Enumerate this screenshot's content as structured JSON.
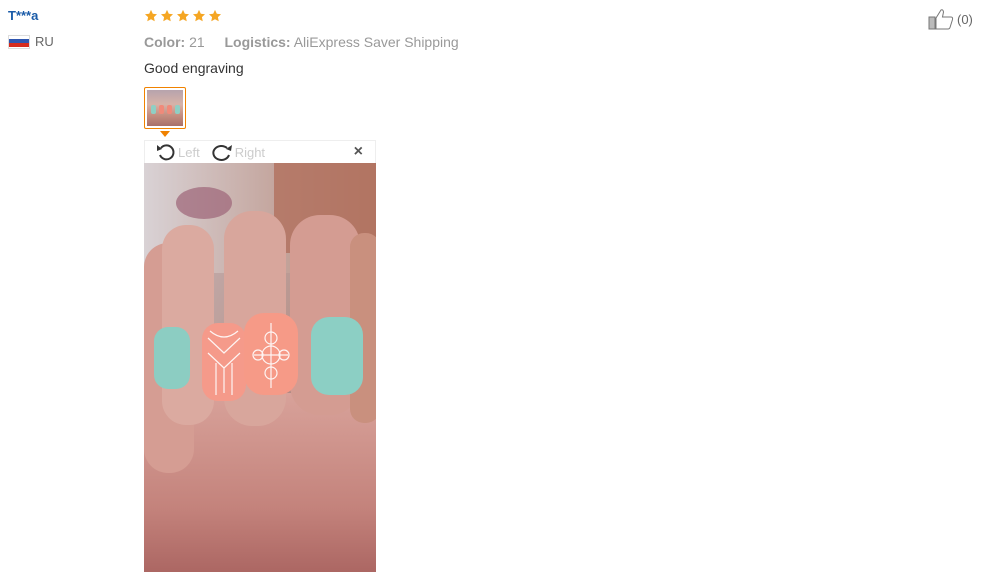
{
  "reviewer": {
    "name": "T***a",
    "country": "RU"
  },
  "review": {
    "rating": 5,
    "attributes": [
      {
        "key": "Color:",
        "value": "21"
      },
      {
        "key": "Logistics:",
        "value": "AliExpress Saver Shipping"
      }
    ],
    "content": "Good engraving"
  },
  "viewer": {
    "rotate_left_label": "Left",
    "rotate_right_label": "Right",
    "close_glyph": "×"
  },
  "helpful": {
    "count": "(0)"
  },
  "colors": {
    "star": "#f5a623",
    "accent": "#f08200",
    "username": "#1a5ba8"
  }
}
